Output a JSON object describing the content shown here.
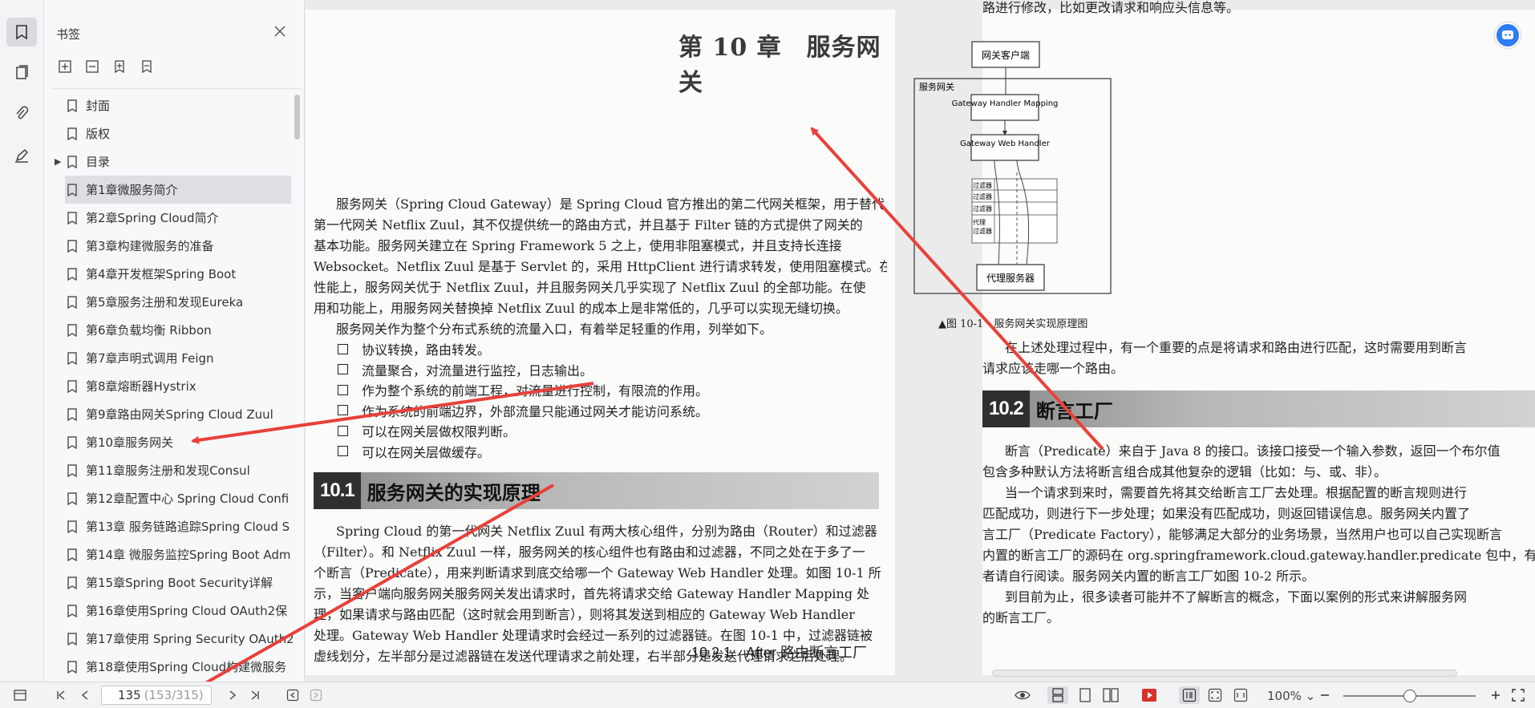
{
  "panel": {
    "title": "书签",
    "items": [
      {
        "label": "封面"
      },
      {
        "label": "版权"
      },
      {
        "label": "目录",
        "expandable": true
      },
      {
        "label": "第1章微服务简介",
        "selected": true
      },
      {
        "label": "第2章Spring Cloud简介"
      },
      {
        "label": "第3章构建微服务的准备"
      },
      {
        "label": "第4章开发框架Spring Boot"
      },
      {
        "label": "第5章服务注册和发现Eureka"
      },
      {
        "label": "第6章负载均衡 Ribbon"
      },
      {
        "label": "第7章声明式调用 Feign"
      },
      {
        "label": "第8章熔断器Hystrix"
      },
      {
        "label": "第9章路由网关Spring Cloud Zuul"
      },
      {
        "label": "第10章服务网关"
      },
      {
        "label": "第11章服务注册和发现Consul"
      },
      {
        "label": "第12章配置中心 Spring Cloud Confi"
      },
      {
        "label": "第13章 服务链路追踪Spring Cloud S"
      },
      {
        "label": "第14章 微服务监控Spring Boot Adm"
      },
      {
        "label": "第15章Spring Boot Security详解"
      },
      {
        "label": "第16章使用Spring Cloud OAuth2保"
      },
      {
        "label": "第17章使用 Spring Security OAuth2"
      },
      {
        "label": "第18章使用Spring Cloud构建微服务"
      }
    ]
  },
  "doc": {
    "chapter_title": "第 10 章　服务网关",
    "intro_lines": [
      "服务网关（Spring Cloud Gateway）是 Spring Cloud 官方推出的第二代网关框架，用于替代",
      "第一代网关 Netflix Zuul，其不仅提供统一的路由方式，并且基于 Filter 链的方式提供了网关的",
      "基本功能。服务网关建立在 Spring Framework 5 之上，使用非阻塞模式，并且支持长连接",
      "Websocket。Netflix Zuul 是基于 Servlet 的，采用 HttpClient 进行请求转发，使用阻塞模式。在",
      "性能上，服务网关优于 Netflix Zuul，并且服务网关几乎实现了 Netflix Zuul 的全部功能。在使",
      "用和功能上，用服务网关替换掉 Netflix Zuul 的成本上是非常低的，几乎可以实现无缝切换。",
      "服务网关作为整个分布式系统的流量入口，有着举足轻重的作用，列举如下。"
    ],
    "bullets": [
      "协议转换，路由转发。",
      "流量聚合，对流量进行监控，日志输出。",
      "作为整个系统的前端工程，对流量进行控制，有限流的作用。",
      "作为系统的前端边界，外部流量只能通过网关才能访问系统。",
      "可以在网关层做权限判断。",
      "可以在网关层做缓存。"
    ],
    "section1": {
      "num": "10.1",
      "title": "服务网关的实现原理"
    },
    "section1_lines": [
      "Spring Cloud 的第一代网关 Netflix Zuul 有两大核心组件，分别为路由（Router）和过滤器",
      "（Filter）。和 Netflix Zuul 一样，服务网关的核心组件也有路由和过滤器，不同之处在于多了一",
      "个断言（Predicate），用来判断请求到底交给哪一个 Gateway Web Handler 处理。如图 10-1 所",
      "示，当客户端向服务网关服务网关发出请求时，首先将请求交给 Gateway Handler Mapping 处",
      "理，如果请求与路由匹配（这时就会用到断言），则将其发送到相应的 Gateway Web Handler",
      "处理。Gateway Web Handler 处理请求时会经过一系列的过滤器链。在图 10-1 中，过滤器链被",
      "虚线划分，左半部分是过滤器链在发送代理请求之前处理，右半部分是发送代理请求之后处理。"
    ],
    "right_top_line": "路进行修改，比如更改请求和响应头信息等。",
    "diagram": {
      "client": "网关客户端",
      "gateway": "服务网关",
      "handler_mapping": "Gateway Handler Mapping",
      "web_handler": "Gateway Web Handler",
      "filters": [
        "过滤器",
        "过滤器",
        "过滤器",
        "代理过滤器"
      ],
      "proxy": "代理服务器"
    },
    "figure_caption": "▲图 10-1　服务网关实现原理图",
    "right_lines_a": [
      "在上述处理过程中，有一个重要的点是将请求和路由进行匹配，这时需要用到断言",
      "请求应该走哪一个路由。"
    ],
    "section2": {
      "num": "10.2",
      "title": "断言工厂"
    },
    "right_lines_b": [
      "断言（Predicate）来自于 Java 8 的接口。该接口接受一个输入参数，返回一个布尔值",
      "包含多种默认方法将断言组合成其他复杂的逻辑（比如：与、或、非）。",
      "当一个请求到来时，需要首先将其交给断言工厂去处理。根据配置的断言规则进行",
      "匹配成功，则进行下一步处理；如果没有匹配成功，则返回错误信息。服务网关内置了",
      "言工厂（Predicate Factory），能够满足大部分的业务场景，当然用户也可以自己实现断言",
      "内置的断言工厂的源码在 org.springframework.cloud.gateway.handler.predicate 包中，有兴",
      "者请自行阅读。服务网关内置的断言工厂如图 10-2 所示。",
      "到目前为止，很多读者可能并不了解断言的概念，下面以案例的形式来讲解服务网",
      "的断言工厂。"
    ],
    "sub_heading": "10.2.1　After 路由断言工厂"
  },
  "status": {
    "page_current": "135",
    "page_total": "(153/315)",
    "zoom": "100%"
  },
  "colors": {
    "accent": "#2f7cf6",
    "arrow": "#e8413a",
    "play": "#d9312b"
  }
}
